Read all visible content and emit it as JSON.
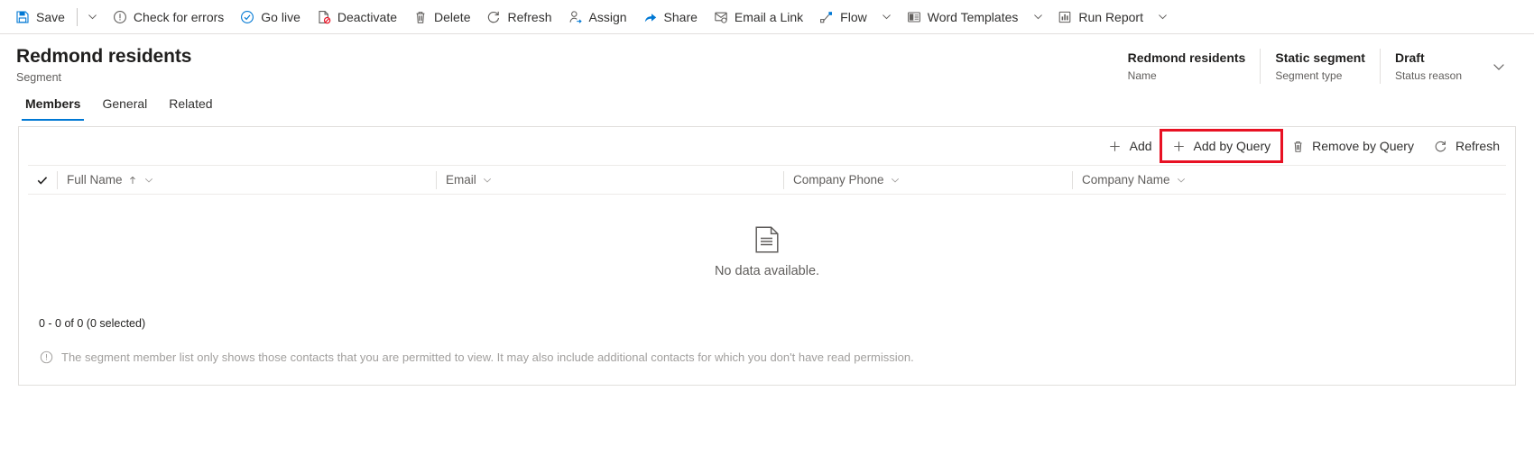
{
  "command_bar": {
    "items": [
      {
        "icon": "save-icon",
        "label": "Save",
        "caret": true,
        "sep_after": false
      },
      {
        "icon": "error-icon",
        "label": "Check for errors",
        "caret": false,
        "sep_after": false
      },
      {
        "icon": "golive-icon",
        "label": "Go live",
        "caret": false,
        "sep_after": false
      },
      {
        "icon": "deactivate-icon",
        "label": "Deactivate",
        "caret": false,
        "sep_after": false
      },
      {
        "icon": "delete-icon",
        "label": "Delete",
        "caret": false,
        "sep_after": false
      },
      {
        "icon": "refresh-icon",
        "label": "Refresh",
        "caret": false,
        "sep_after": false
      },
      {
        "icon": "assign-icon",
        "label": "Assign",
        "caret": false,
        "sep_after": false
      },
      {
        "icon": "share-icon",
        "label": "Share",
        "caret": false,
        "sep_after": false
      },
      {
        "icon": "email-link-icon",
        "label": "Email a Link",
        "caret": false,
        "sep_after": false
      },
      {
        "icon": "flow-icon",
        "label": "Flow",
        "caret": true,
        "sep_after": false
      },
      {
        "icon": "word-template-icon",
        "label": "Word Templates",
        "caret": true,
        "sep_after": false
      },
      {
        "icon": "run-report-icon",
        "label": "Run Report",
        "caret": true,
        "sep_after": false
      }
    ]
  },
  "record_header": {
    "title": "Redmond residents",
    "subtitle": "Segment",
    "fields": [
      {
        "value": "Redmond residents",
        "label": "Name"
      },
      {
        "value": "Static segment",
        "label": "Segment type"
      },
      {
        "value": "Draft",
        "label": "Status reason"
      }
    ]
  },
  "tabs": [
    {
      "label": "Members",
      "active": true
    },
    {
      "label": "General",
      "active": false
    },
    {
      "label": "Related",
      "active": false
    }
  ],
  "grid": {
    "commands": [
      {
        "icon": "add-icon",
        "label": "Add",
        "highlighted": false
      },
      {
        "icon": "add-icon",
        "label": "Add by Query",
        "highlighted": true
      },
      {
        "icon": "trash-icon",
        "label": "Remove by Query",
        "highlighted": false
      },
      {
        "icon": "refresh-icon",
        "label": "Refresh",
        "highlighted": false
      }
    ],
    "columns": [
      {
        "label": "Full Name",
        "sorted": true
      },
      {
        "label": "Email",
        "sorted": false
      },
      {
        "label": "Company Phone",
        "sorted": false
      },
      {
        "label": "Company Name",
        "sorted": false
      }
    ],
    "empty_message": "No data available.",
    "record_count": "0 - 0 of 0 (0 selected)",
    "note": "The segment member list only shows those contacts that you are permitted to view. It may also include additional contacts for which you don't have read permission."
  },
  "colors": {
    "accent": "#0078d4",
    "highlight": "#e81123",
    "text": "#323130",
    "muted": "#605e5c"
  }
}
